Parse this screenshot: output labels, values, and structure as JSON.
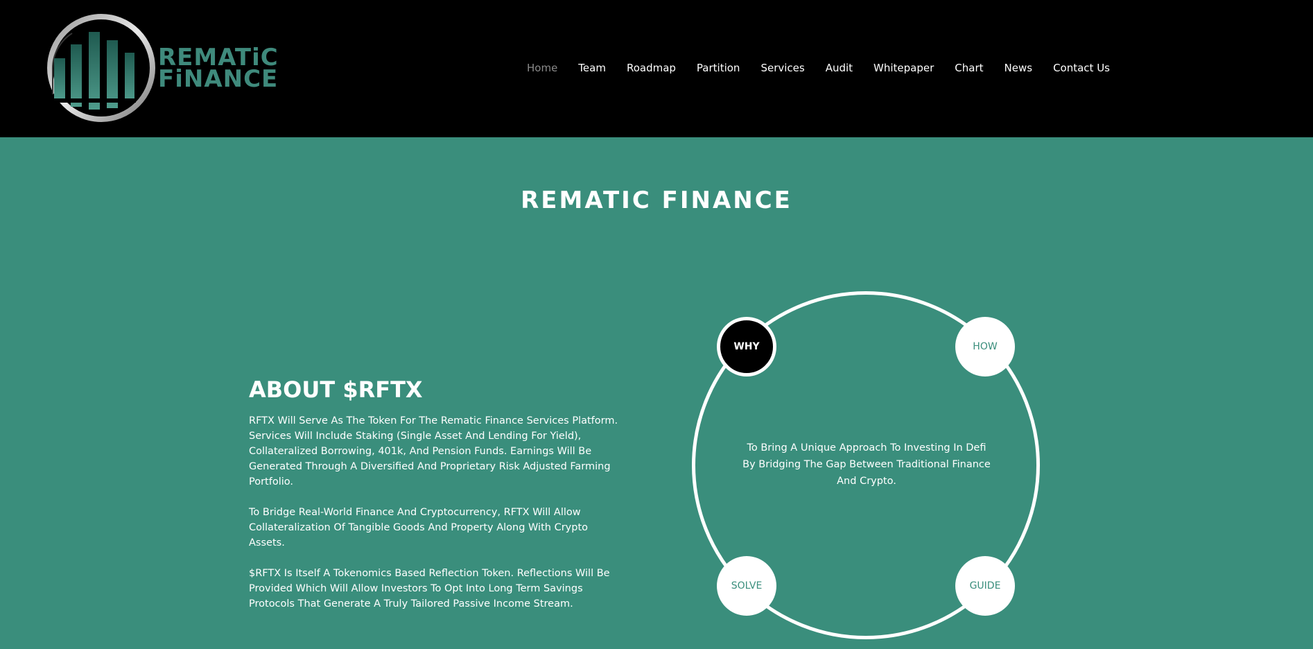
{
  "logo": {
    "line1": "REMATiC",
    "line2": "FiNANCE"
  },
  "nav": {
    "items": [
      {
        "label": "Home",
        "active": true
      },
      {
        "label": "Team"
      },
      {
        "label": "Roadmap"
      },
      {
        "label": "Partition"
      },
      {
        "label": "Services"
      },
      {
        "label": "Audit"
      },
      {
        "label": "Whitepaper"
      },
      {
        "label": "Chart"
      },
      {
        "label": "News"
      },
      {
        "label": "Contact Us"
      }
    ]
  },
  "main": {
    "title": "REMATIC FINANCE",
    "about": {
      "heading": "ABOUT $RFTX",
      "paragraphs": [
        "RFTX Will Serve As The Token For The Rematic Finance Services Platform. Services Will Include Staking (Single Asset And Lending For Yield), Collateralized Borrowing, 401k, And Pension Funds. Earnings Will Be Generated Through A Diversified And Proprietary Risk Adjusted Farming Portfolio.",
        "To Bridge Real-World Finance And Cryptocurrency, RFTX Will Allow Collateralization Of Tangible Goods And Property Along With Crypto Assets.",
        "$RFTX Is Itself A Tokenomics Based Reflection Token. Reflections Will Be Provided Which Will Allow Investors To Opt Into Long Term Savings Protocols That Generate A Truly Tailored Passive Income Stream."
      ]
    },
    "cycle": {
      "nodes": [
        {
          "label": "WHY",
          "active": true
        },
        {
          "label": "HOW"
        },
        {
          "label": "SOLVE"
        },
        {
          "label": "GUIDE"
        }
      ],
      "center_text": "To Bring A Unique Approach To Investing In Defi By Bridging The Gap Between Traditional Finance And Crypto."
    }
  },
  "colors": {
    "background": "#3a8e7c",
    "header": "#000000",
    "brand": "#3f8a7c",
    "text": "#ffffff",
    "nav_active": "#8a8a8a"
  }
}
